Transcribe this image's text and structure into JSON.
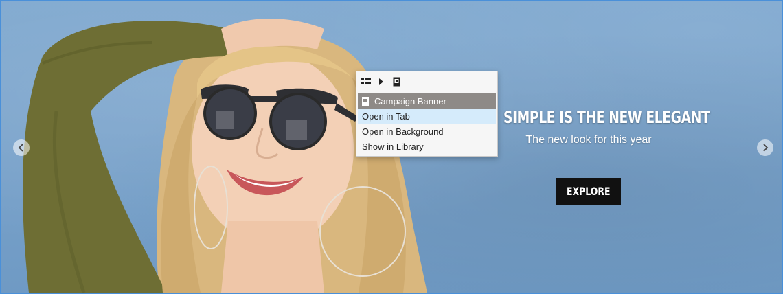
{
  "hero": {
    "title": "SIMPLE IS THE NEW ELEGANT",
    "subtitle": "The new look for this year",
    "cta_label": "EXPLORE"
  },
  "carousel": {
    "prev_icon": "chevron-left-icon",
    "next_icon": "chevron-right-icon"
  },
  "context_menu": {
    "toolbar_icons": [
      "list-view-icon",
      "play-arrow-icon",
      "document-icon"
    ],
    "header_icon": "document-icon",
    "header_label": "Campaign Banner",
    "items": [
      {
        "label": "Open in Tab"
      },
      {
        "label": "Open in Background"
      },
      {
        "label": "Show in Library"
      }
    ]
  },
  "colors": {
    "frame_border": "#4a90d9",
    "cta_background": "#111111",
    "menu_header": "#8e8a87",
    "menu_highlight": "#d5ebfb"
  }
}
